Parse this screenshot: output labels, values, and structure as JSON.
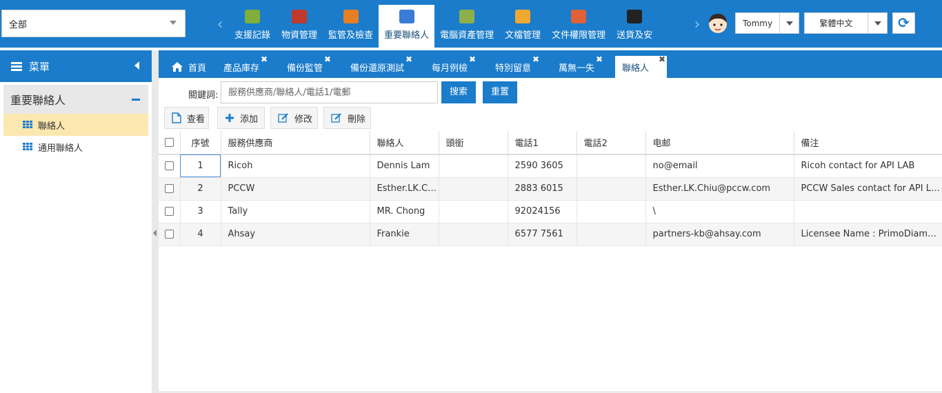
{
  "scope": {
    "value": "全部"
  },
  "nav": {
    "items": [
      {
        "label": "支援記錄",
        "icon": "cube-icon",
        "color": "#7fae3a"
      },
      {
        "label": "物資管理",
        "icon": "boxes-icon",
        "color": "#c0392b"
      },
      {
        "label": "監管及檢查",
        "icon": "calendar-icon",
        "color": "#e67e22"
      },
      {
        "label": "重要聯絡人",
        "icon": "contact-card-icon",
        "color": "#3a7bd5"
      },
      {
        "label": "電腦資產管理",
        "icon": "money-icon",
        "color": "#8db04a"
      },
      {
        "label": "文檔管理",
        "icon": "folder-icon",
        "color": "#f0a830"
      },
      {
        "label": "文件權限管理",
        "icon": "folder-plus-icon",
        "color": "#e0603a"
      },
      {
        "label": "送貨及安",
        "icon": "truck-icon",
        "color": "#222222"
      }
    ],
    "active_index": 3
  },
  "user": {
    "name": "Tommy"
  },
  "language": {
    "value": "繁體中文"
  },
  "sidebar": {
    "title": "菜單",
    "group": "重要聯絡人",
    "items": [
      {
        "label": "聯絡人",
        "active": true
      },
      {
        "label": "通用聯絡人",
        "active": false
      }
    ]
  },
  "tabs": [
    {
      "label": "首頁"
    },
    {
      "label": "產品庫存"
    },
    {
      "label": "備份監管"
    },
    {
      "label": "備份還原測試"
    },
    {
      "label": "每月例檢"
    },
    {
      "label": "特別留意"
    },
    {
      "label": "萬無一失"
    },
    {
      "label": "聯絡人"
    }
  ],
  "search": {
    "label": "關鍵詞:",
    "placeholder": "服務供應商/聯絡人/電話1/電郵",
    "search_label": "搜索",
    "reset_label": "重置"
  },
  "toolbar": {
    "view": "查看",
    "add": "添加",
    "edit": "修改",
    "delete": "刪除"
  },
  "table": {
    "headers": [
      "序號",
      "服務供應商",
      "聯絡人",
      "頭銜",
      "電話1",
      "電話2",
      "电邮",
      "備注"
    ],
    "rows": [
      [
        "1",
        "Ricoh",
        "Dennis Lam",
        "",
        "2590 3605",
        "",
        "no@email",
        "Ricoh contact for API LAB"
      ],
      [
        "2",
        "PCCW",
        "Esther.LK.Chiu",
        "",
        "2883 6015",
        "",
        "Esther.LK.Chiu@pccw.com",
        "PCCW Sales contact for API LAB"
      ],
      [
        "3",
        "Tally",
        "MR. Chong",
        "",
        "92024156",
        "",
        "\\",
        ""
      ],
      [
        "4",
        "Ahsay",
        "Frankie",
        "",
        "6577 7561",
        "",
        "partners-kb@ahsay.com",
        "Licensee Name : PrimoDiamond"
      ]
    ]
  }
}
